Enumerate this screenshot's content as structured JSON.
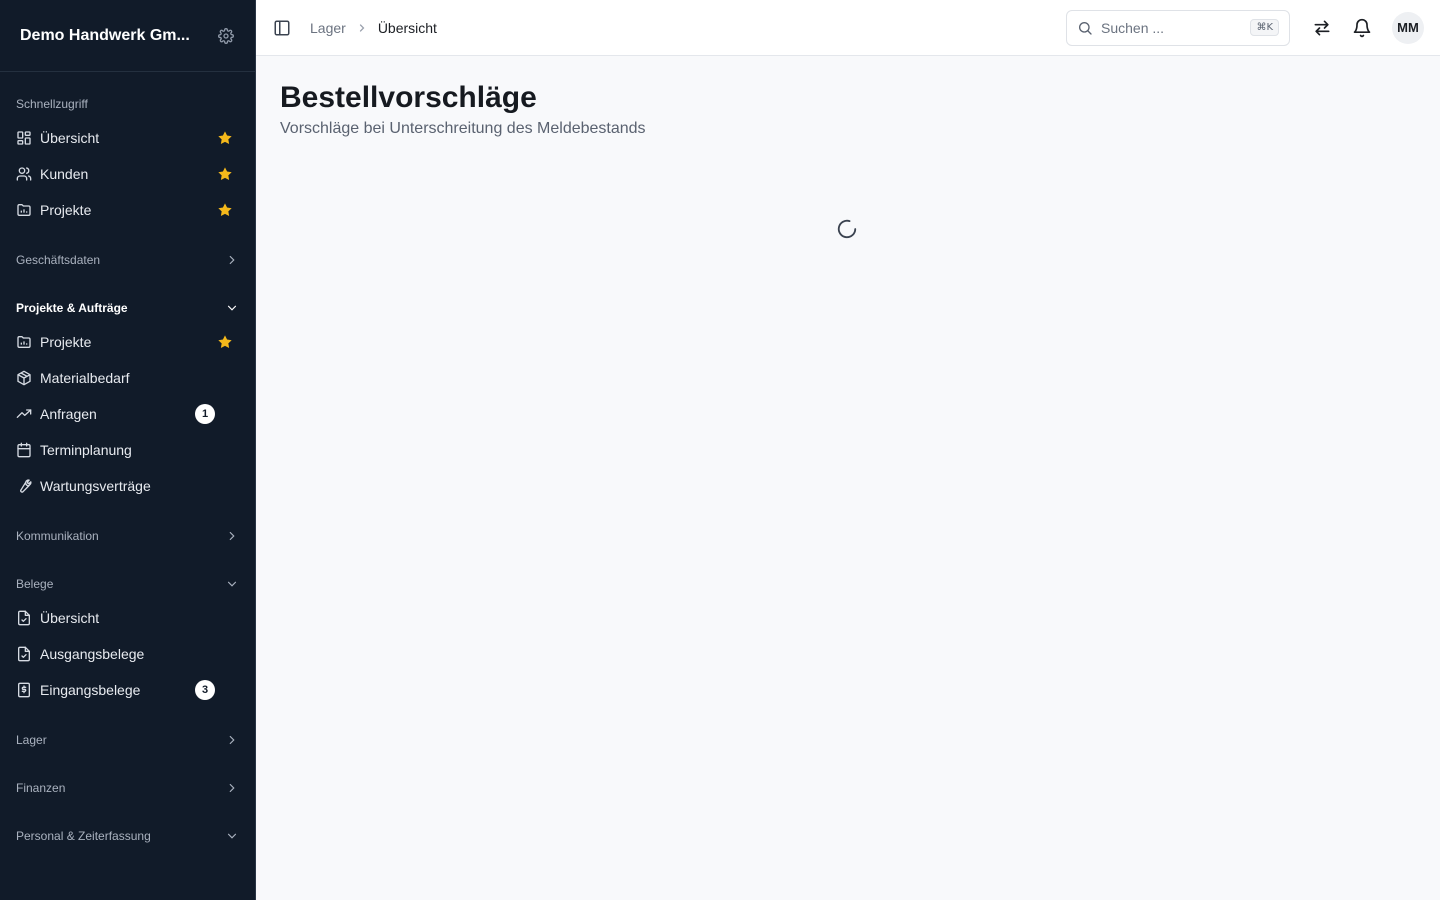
{
  "app": {
    "company": "Demo Handwerk Gm...",
    "user_initials": "MM"
  },
  "sidebar": {
    "quick": {
      "label": "Schnellzugriff",
      "items": [
        {
          "label": "Übersicht",
          "icon": "dashboard-icon",
          "favorite": true
        },
        {
          "label": "Kunden",
          "icon": "users-icon",
          "favorite": true
        },
        {
          "label": "Projekte",
          "icon": "folder-chart-icon",
          "favorite": true
        }
      ]
    },
    "business": {
      "label": "Geschäftsdaten",
      "expanded": false
    },
    "projects": {
      "label": "Projekte & Aufträge",
      "expanded": true,
      "items": [
        {
          "label": "Projekte",
          "icon": "folder-chart-icon",
          "favorite": true
        },
        {
          "label": "Materialbedarf",
          "icon": "package-icon"
        },
        {
          "label": "Anfragen",
          "icon": "trending-up-icon",
          "badge": "1"
        },
        {
          "label": "Terminplanung",
          "icon": "calendar-icon"
        },
        {
          "label": "Wartungsverträge",
          "icon": "wrench-icon"
        }
      ]
    },
    "communication": {
      "label": "Kommunikation",
      "expanded": false
    },
    "documents": {
      "label": "Belege",
      "expanded": true,
      "items": [
        {
          "label": "Übersicht",
          "icon": "file-check-icon"
        },
        {
          "label": "Ausgangsbelege",
          "icon": "file-check-icon"
        },
        {
          "label": "Eingangsbelege",
          "icon": "receipt-icon",
          "badge": "3"
        }
      ]
    },
    "storage": {
      "label": "Lager",
      "expanded": false
    },
    "finance": {
      "label": "Finanzen",
      "expanded": false
    },
    "personnel": {
      "label": "Personal & Zeiterfassung",
      "expanded": true
    }
  },
  "topbar": {
    "breadcrumb": [
      "Lager",
      "Übersicht"
    ],
    "search_placeholder": "Suchen ...",
    "search_shortcut": "⌘K"
  },
  "main": {
    "title": "Bestellvorschläge",
    "subtitle": "Vorschläge bei Unterschreitung des Meldebestands"
  },
  "colors": {
    "sidebar_bg": "#111b29",
    "favorite_star": "#f5b91b",
    "page_bg": "#f8f9fb"
  }
}
